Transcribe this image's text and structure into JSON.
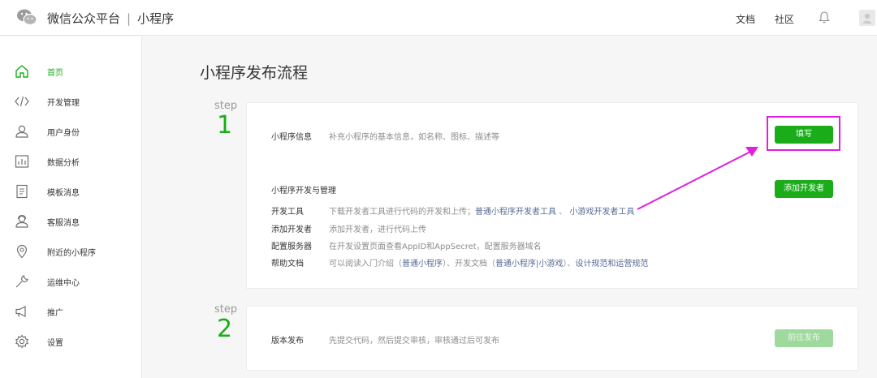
{
  "header": {
    "platform_name": "微信公众平台",
    "separator": "|",
    "section_name": "小程序",
    "docs_label": "文档",
    "community_label": "社区"
  },
  "sidebar": {
    "items": [
      {
        "label": "首页",
        "icon": "home-icon"
      },
      {
        "label": "开发管理",
        "icon": "code-icon"
      },
      {
        "label": "用户身份",
        "icon": "user-icon"
      },
      {
        "label": "数据分析",
        "icon": "chart-icon"
      },
      {
        "label": "模板消息",
        "icon": "document-icon"
      },
      {
        "label": "客服消息",
        "icon": "service-icon"
      },
      {
        "label": "附近的小程序",
        "icon": "location-icon"
      },
      {
        "label": "运维中心",
        "icon": "wrench-icon"
      },
      {
        "label": "推广",
        "icon": "megaphone-icon"
      },
      {
        "label": "设置",
        "icon": "gear-icon"
      }
    ]
  },
  "main": {
    "title": "小程序发布流程",
    "steps": [
      {
        "word": "step",
        "number": "1",
        "info_label": "小程序信息",
        "info_desc": "补充小程序的基本信息，如名称、图标、描述等",
        "fill_button": "填写",
        "dev_section_title": "小程序开发与管理",
        "add_dev_button": "添加开发者",
        "rows": [
          {
            "label": "开发工具",
            "desc": "下载开发者工具进行代码的开发和上传；",
            "link1": "普通小程序开发者工具",
            "mid": " 、 ",
            "link2": "小游戏开发者工具"
          },
          {
            "label": "添加开发者",
            "desc": "添加开发者，进行代码上传"
          },
          {
            "label": "配置服务器",
            "desc": "在开发设置页面查看AppID和AppSecret，配置服务器域名"
          },
          {
            "label": "帮助文档",
            "desc": "可以阅读入门介绍（",
            "link1": "普通小程序",
            "mid": "）、开发文档（",
            "link2": "普通小程序|小游戏",
            "end": "）、",
            "link3": "设计规范和运营规范"
          }
        ]
      },
      {
        "word": "step",
        "number": "2",
        "label": "版本发布",
        "desc": "先提交代码，然后提交审核，审核通过后可发布",
        "button": "前往发布"
      }
    ]
  },
  "colors": {
    "accent": "#1aad19",
    "link": "#576b95",
    "annotation": "#e020e0"
  }
}
